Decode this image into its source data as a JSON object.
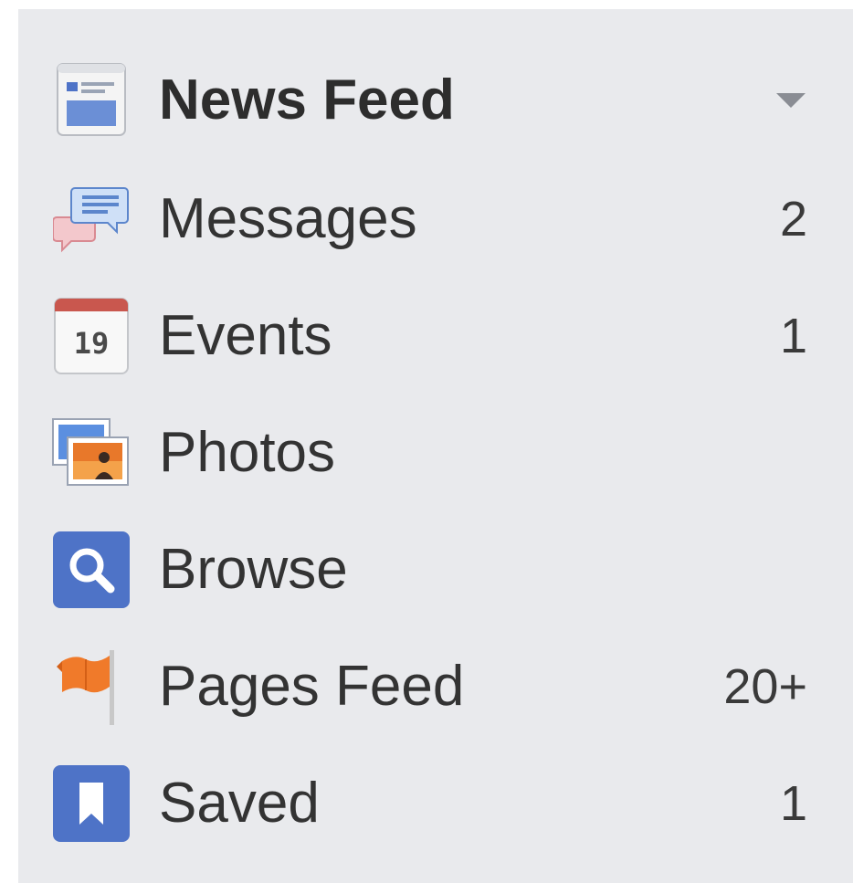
{
  "nav": {
    "items": [
      {
        "label": "News Feed",
        "icon": "news-feed-icon",
        "count": "",
        "bold": true
      },
      {
        "label": "Messages",
        "icon": "messages-icon",
        "count": "2"
      },
      {
        "label": "Events",
        "icon": "events-calendar-icon",
        "count": "1",
        "calendar_day": "19"
      },
      {
        "label": "Photos",
        "icon": "photos-icon",
        "count": ""
      },
      {
        "label": "Browse",
        "icon": "browse-search-icon",
        "count": ""
      },
      {
        "label": "Pages Feed",
        "icon": "pages-flag-icon",
        "count": "20+"
      },
      {
        "label": "Saved",
        "icon": "saved-bookmark-icon",
        "count": "1"
      }
    ]
  },
  "colors": {
    "panel_background": "#e9eaed",
    "text": "#333333",
    "brand_blue": "#4e73c7",
    "calendar_red": "#c9574e",
    "flag_orange": "#f07a2a"
  }
}
